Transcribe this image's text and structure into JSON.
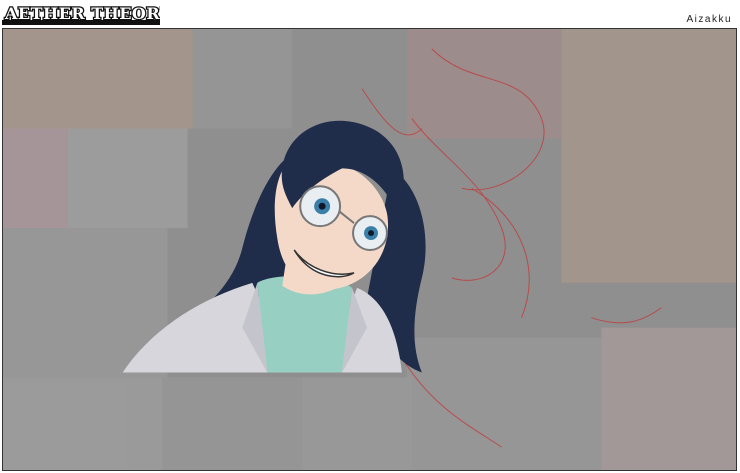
{
  "header": {
    "logo_text": "AETHER THEOREM",
    "author": "Aizakku"
  },
  "colors": {
    "background_gray": "#8f8f8f",
    "hair_navy": "#1f2c4a",
    "skin": "#f4d8c8",
    "coat": "#d6d6dc",
    "shirt": "#97cfc2",
    "eye_blue": "#3a7fa8",
    "sketch_red": "#c23a3a"
  }
}
